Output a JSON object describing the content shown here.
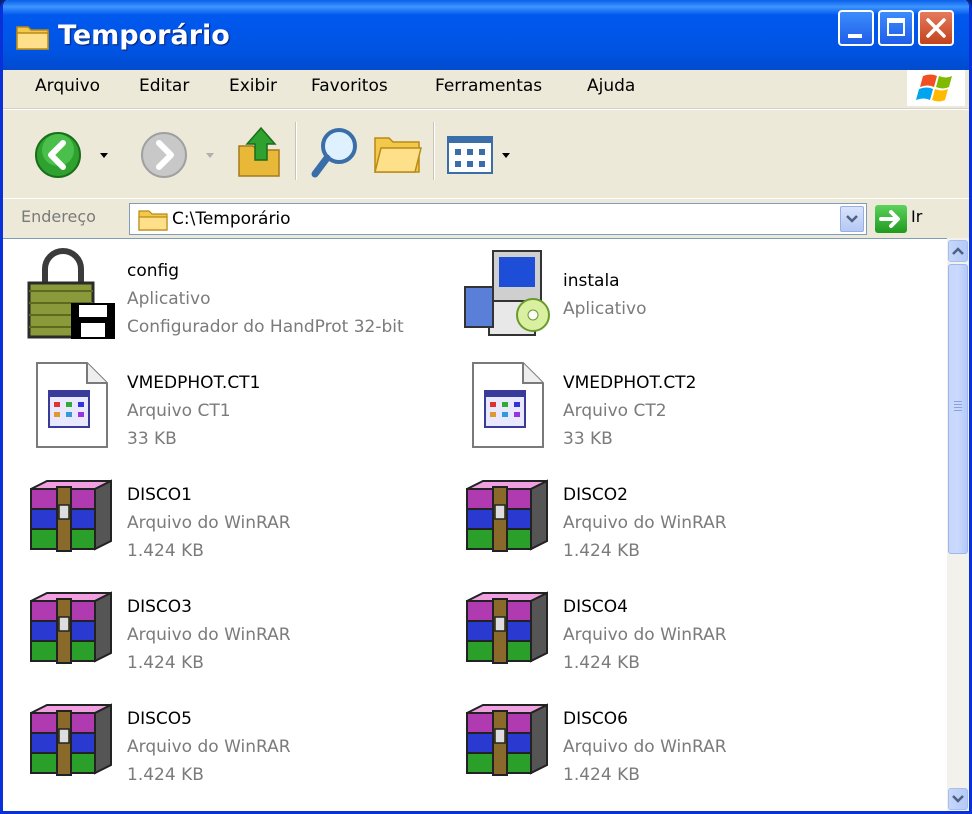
{
  "window": {
    "title": "Temporário"
  },
  "menu": [
    "Arquivo",
    "Editar",
    "Exibir",
    "Favoritos",
    "Ferramentas",
    "Ajuda"
  ],
  "address": {
    "label": "Endereço",
    "path": "C:\\Temporário",
    "go_label": "Ir"
  },
  "files": [
    {
      "name": "config",
      "type": "Aplicativo",
      "detail": "Configurador do HandProt 32-bit",
      "icon": "padlock-disk-icon"
    },
    {
      "name": "instala",
      "type": "Aplicativo",
      "detail": "",
      "icon": "setup-installer-icon"
    },
    {
      "name": "VMEDPHOT.CT1",
      "type": "Arquivo CT1",
      "detail": "33 KB",
      "icon": "document-file-icon"
    },
    {
      "name": "VMEDPHOT.CT2",
      "type": "Arquivo CT2",
      "detail": "33 KB",
      "icon": "document-file-icon"
    },
    {
      "name": "DISCO1",
      "type": "Arquivo do WinRAR",
      "detail": "1.424 KB",
      "icon": "winrar-archive-icon"
    },
    {
      "name": "DISCO2",
      "type": "Arquivo do WinRAR",
      "detail": "1.424 KB",
      "icon": "winrar-archive-icon"
    },
    {
      "name": "DISCO3",
      "type": "Arquivo do WinRAR",
      "detail": "1.424 KB",
      "icon": "winrar-archive-icon"
    },
    {
      "name": "DISCO4",
      "type": "Arquivo do WinRAR",
      "detail": "1.424 KB",
      "icon": "winrar-archive-icon"
    },
    {
      "name": "DISCO5",
      "type": "Arquivo do WinRAR",
      "detail": "1.424 KB",
      "icon": "winrar-archive-icon"
    },
    {
      "name": "DISCO6",
      "type": "Arquivo do WinRAR",
      "detail": "1.424 KB",
      "icon": "winrar-archive-icon"
    }
  ],
  "colors": {
    "titlebar": "#0054e3",
    "close": "#c1431d",
    "secondary_text": "#7b7b7b"
  }
}
